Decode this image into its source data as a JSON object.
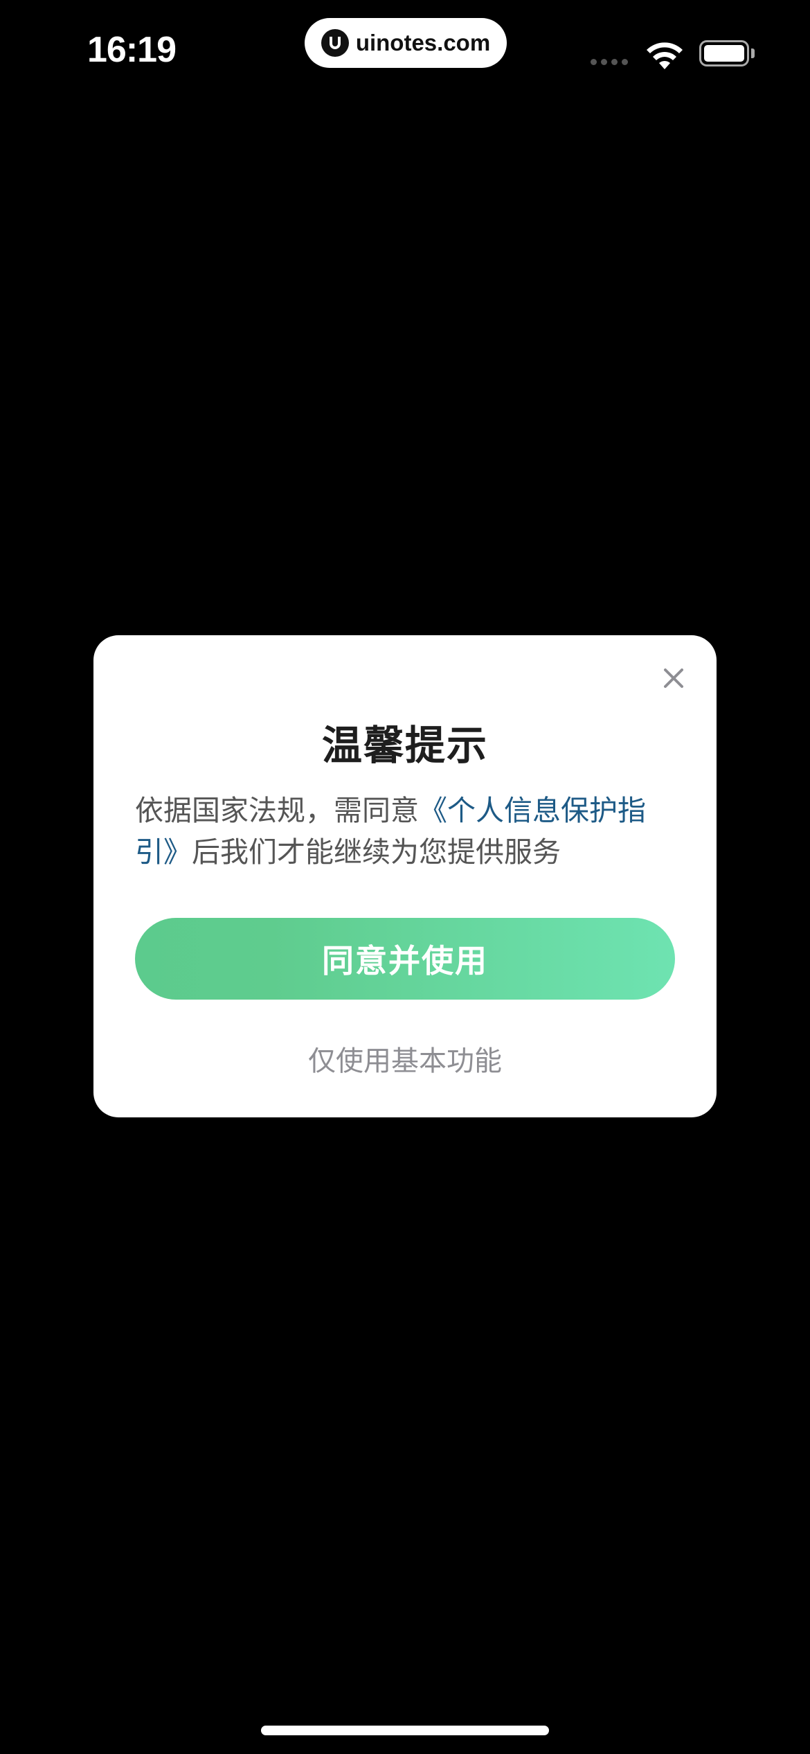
{
  "status_bar": {
    "time": "16:19",
    "url": "uinotes.com"
  },
  "dialog": {
    "title": "温馨提示",
    "body_prefix": "依据国家法规，需同意",
    "body_link": "《个人信息保护指引》",
    "body_suffix": "后我们才能继续为您提供服务",
    "agree_label": "同意并使用",
    "basic_label": "仅使用基本功能"
  },
  "colors": {
    "accent_start": "#5ccb8d",
    "accent_end": "#6ee3b1",
    "link": "#1d5a86"
  }
}
